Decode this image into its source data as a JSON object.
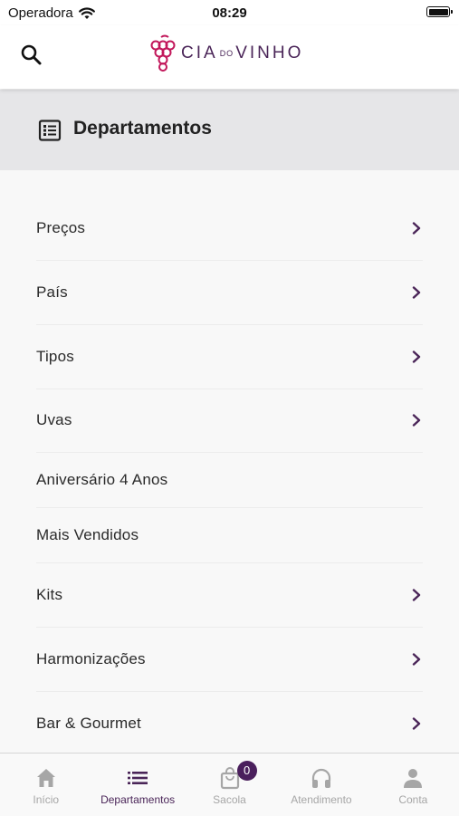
{
  "status_bar": {
    "carrier": "Operadora",
    "time": "08:29"
  },
  "header": {
    "logo_text_a": "CIA",
    "logo_text_do": "DO",
    "logo_text_b": "VINHO"
  },
  "section": {
    "title": "Departamentos"
  },
  "colors": {
    "brand": "#4a2558",
    "accent_grape": "#c2185b",
    "badge": "#4a1f5c",
    "inactive": "#a6a6a6"
  },
  "departments": [
    {
      "label": "Preços",
      "has_chevron": true
    },
    {
      "label": "País",
      "has_chevron": true
    },
    {
      "label": "Tipos",
      "has_chevron": true
    },
    {
      "label": "Uvas",
      "has_chevron": true
    },
    {
      "label": "Aniversário 4 Anos",
      "has_chevron": false
    },
    {
      "label": "Mais Vendidos",
      "has_chevron": false
    },
    {
      "label": "Kits",
      "has_chevron": true
    },
    {
      "label": "Harmonizações",
      "has_chevron": true
    },
    {
      "label": "Bar & Gourmet",
      "has_chevron": true
    }
  ],
  "tabs": [
    {
      "label": "Início",
      "icon": "home-icon",
      "active": false
    },
    {
      "label": "Departamentos",
      "icon": "list-icon",
      "active": true
    },
    {
      "label": "Sacola",
      "icon": "bag-icon",
      "active": false,
      "badge": "0"
    },
    {
      "label": "Atendimento",
      "icon": "headphones-icon",
      "active": false
    },
    {
      "label": "Conta",
      "icon": "person-icon",
      "active": false
    }
  ]
}
